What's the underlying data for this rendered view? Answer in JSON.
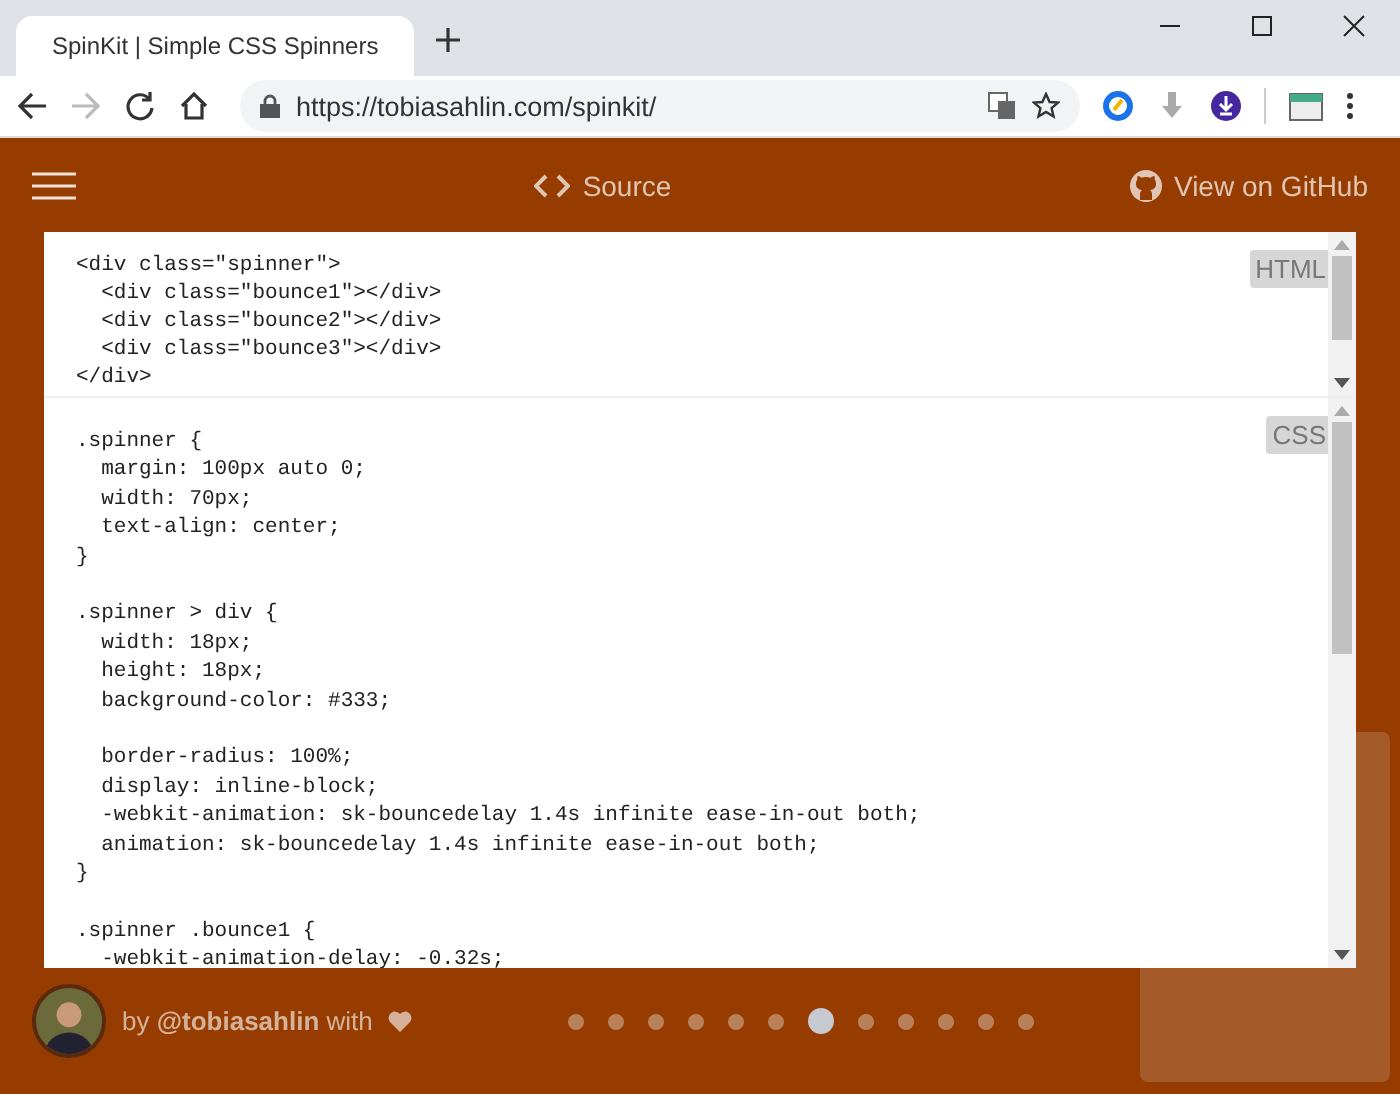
{
  "browser": {
    "tab": {
      "title": "SpinKit | Simple CSS Spinners"
    },
    "url": "https://tobiasahlin.com/spinkit/",
    "forward_disabled": true
  },
  "header": {
    "source_label": "Source",
    "github_label": "View on GitHub"
  },
  "panes": [
    {
      "label": "HTML",
      "code": "<div class=\"spinner\">\n  <div class=\"bounce1\"></div>\n  <div class=\"bounce2\"></div>\n  <div class=\"bounce3\"></div>\n</div>"
    },
    {
      "label": "CSS",
      "code": ".spinner {\n  margin: 100px auto 0;\n  width: 70px;\n  text-align: center;\n}\n\n.spinner > div {\n  width: 18px;\n  height: 18px;\n  background-color: #333;\n\n  border-radius: 100%;\n  display: inline-block;\n  -webkit-animation: sk-bouncedelay 1.4s infinite ease-in-out both;\n  animation: sk-bouncedelay 1.4s infinite ease-in-out both;\n}\n\n.spinner .bounce1 {\n  -webkit-animation-delay: -0.32s;"
    }
  ],
  "footer": {
    "credit": "by **@tobiasahlin** with"
  },
  "dots": [
    {
      "selected": false
    },
    {
      "selected": false
    },
    {
      "selected": false
    },
    {
      "selected": false
    },
    {
      "selected": false
    },
    {
      "selected": false
    },
    {
      "selected": true
    },
    {
      "selected": false
    },
    {
      "selected": false
    },
    {
      "selected": false
    },
    {
      "selected": false
    },
    {
      "selected": false
    }
  ]
}
